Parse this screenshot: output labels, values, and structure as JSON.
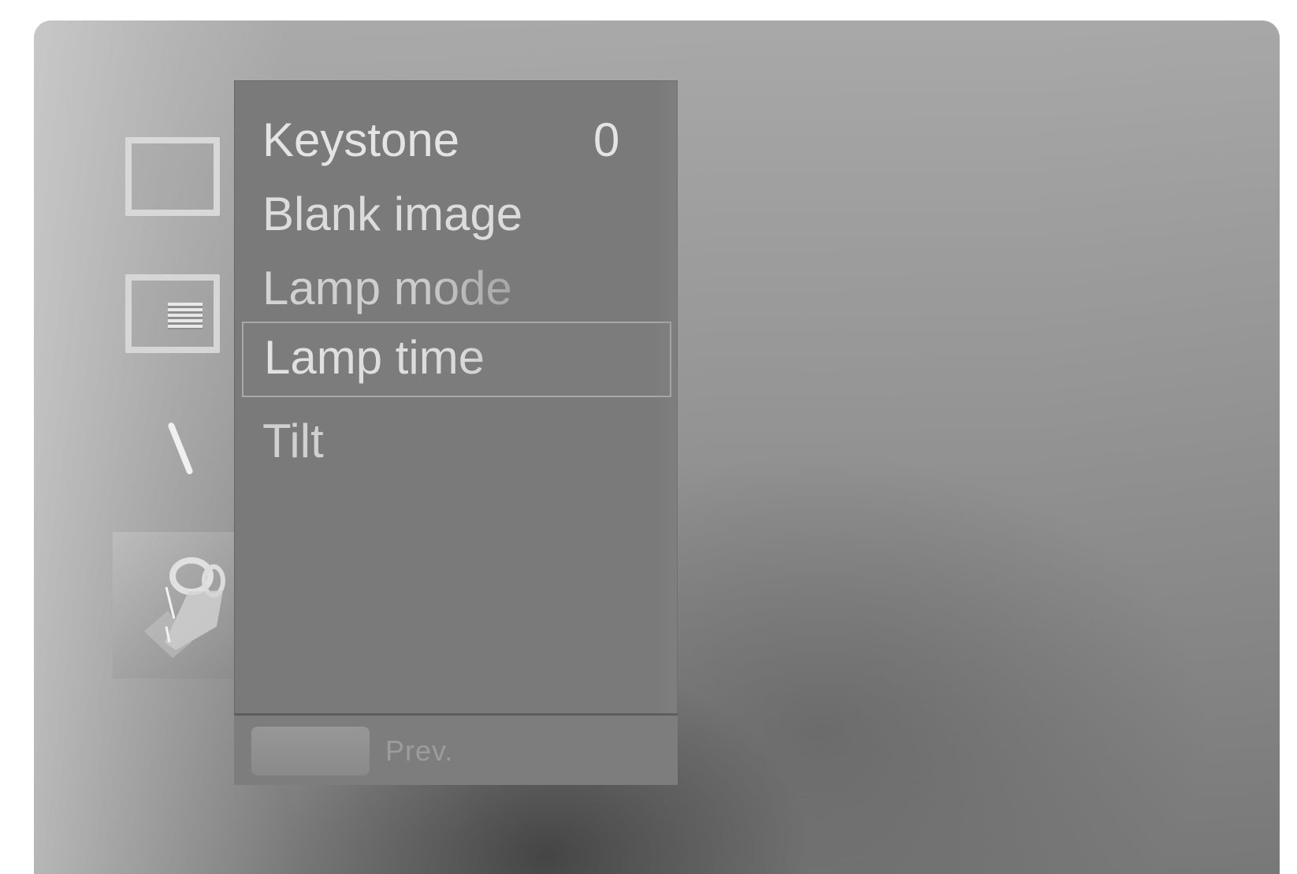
{
  "menu": {
    "items": [
      {
        "label": "Keystone",
        "value": "0"
      },
      {
        "label": "Blank image",
        "value": ""
      },
      {
        "label": "Lamp mode",
        "value": ""
      },
      {
        "label": "Lamp time",
        "value": ""
      },
      {
        "label": "Tilt",
        "value": ""
      }
    ],
    "selected_index": 3
  },
  "footer": {
    "prev_label": "Prev."
  },
  "sidebar": {
    "icons": [
      "picture-icon",
      "screen-icon",
      "audio-icon",
      "settings-icon"
    ],
    "active_icon": "settings-icon"
  }
}
